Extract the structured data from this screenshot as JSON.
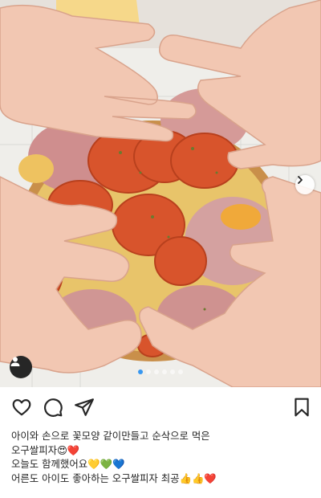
{
  "post": {
    "image_alt": "Hands forming a flower shape around a pizza topped with pepperoni and ham",
    "carousel": {
      "dot_count": 6,
      "active_index": 0
    },
    "icons": {
      "like": "heart-icon",
      "comment": "comment-icon",
      "share": "paper-plane-icon",
      "save": "bookmark-icon",
      "next": "chevron-right-icon",
      "tags": "user-icon"
    },
    "caption": [
      "아이와 손으로 꽃모양 같이만들고 순삭으로 먹은",
      "오구쌀피자😍❤️",
      "오늘도 함께했어요💛💚💙",
      "어른도 아이도 좋아하는 오구쌀피자 최공👍👍❤️"
    ]
  }
}
